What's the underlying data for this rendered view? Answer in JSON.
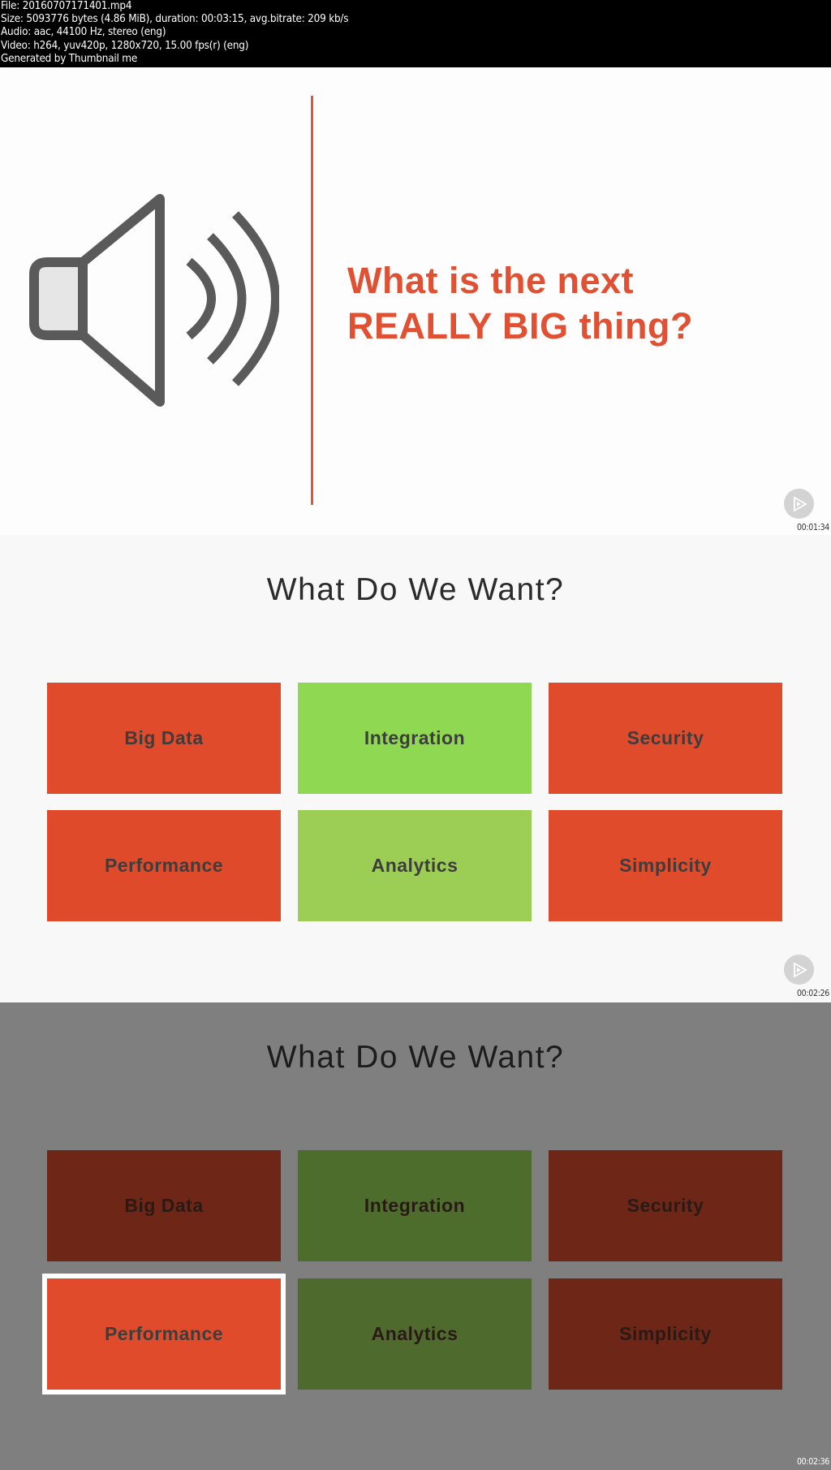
{
  "file_info": {
    "lines": [
      "File: 20160707171401.mp4",
      "Size: 5093776 bytes (4.86 MiB), duration: 00:03:15, avg.bitrate: 209 kb/s",
      "Audio: aac, 44100 Hz, stereo (eng)",
      "Video: h264, yuv420p, 1280x720, 15.00 fps(r) (eng)",
      "Generated by Thumbnail me"
    ]
  },
  "frames": [
    {
      "type": "speaker-slide",
      "headline_line1": "What is the next",
      "headline_line2": "REALLY BIG thing?",
      "icon": "speaker-volume-icon",
      "play_icon": "play-logo-icon",
      "timestamp": "00:01:34",
      "colors": {
        "accent": "#e05133",
        "divider": "#d65a3e",
        "icon": "#5a5a5a"
      }
    },
    {
      "type": "grid-slide",
      "title": "What Do We Want?",
      "tiles": [
        {
          "label": "Big Data",
          "color": "#e04b2c"
        },
        {
          "label": "Integration",
          "color": "#8fd851"
        },
        {
          "label": "Security",
          "color": "#e04b2c"
        },
        {
          "label": "Performance",
          "color": "#df4a2b"
        },
        {
          "label": "Analytics",
          "color": "#9ccd55"
        },
        {
          "label": "Simplicity",
          "color": "#e04b2c"
        }
      ],
      "play_icon": "play-logo-icon",
      "timestamp": "00:02:26"
    },
    {
      "type": "grid-slide-dimmed",
      "title": "What Do We Want?",
      "selected_tile": "Performance",
      "tiles": [
        {
          "label": "Big Data",
          "color": "#6e2617",
          "selected": false
        },
        {
          "label": "Integration",
          "color": "#4d6d2c",
          "selected": false
        },
        {
          "label": "Security",
          "color": "#6e2617",
          "selected": false
        },
        {
          "label": "Performance",
          "color": "#e04b2c",
          "selected": true
        },
        {
          "label": "Analytics",
          "color": "#4e6b2d",
          "selected": false
        },
        {
          "label": "Simplicity",
          "color": "#6e2617",
          "selected": false
        }
      ],
      "timestamp": "00:02:36"
    }
  ]
}
